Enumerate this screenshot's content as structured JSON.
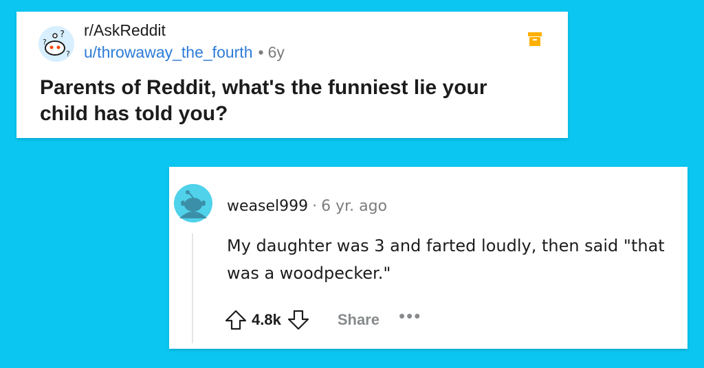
{
  "post": {
    "subreddit": "r/AskReddit",
    "username": "u/throwaway_the_fourth",
    "separator": "•",
    "age": "6y",
    "title": "Parents of Reddit, what's the funniest lie your child has told you?",
    "icons": {
      "avatar": "snoo-question-avatar",
      "archive": "archive-icon"
    }
  },
  "comment": {
    "username": "weasel999",
    "separator": "·",
    "age": "6 yr. ago",
    "body": "My daughter was 3 and farted loudly, then said \"that was a woodpecker.\"",
    "score": "4.8k",
    "share_label": "Share",
    "more_label": "•••",
    "icons": {
      "avatar": "snoo-avatar",
      "upvote": "upvote-icon",
      "downvote": "downvote-icon"
    }
  },
  "colors": {
    "background": "#0bc6f0",
    "username_link": "#2d7bd8",
    "archive": "#ffb000",
    "avatar_bg": "#4fd2ea"
  }
}
